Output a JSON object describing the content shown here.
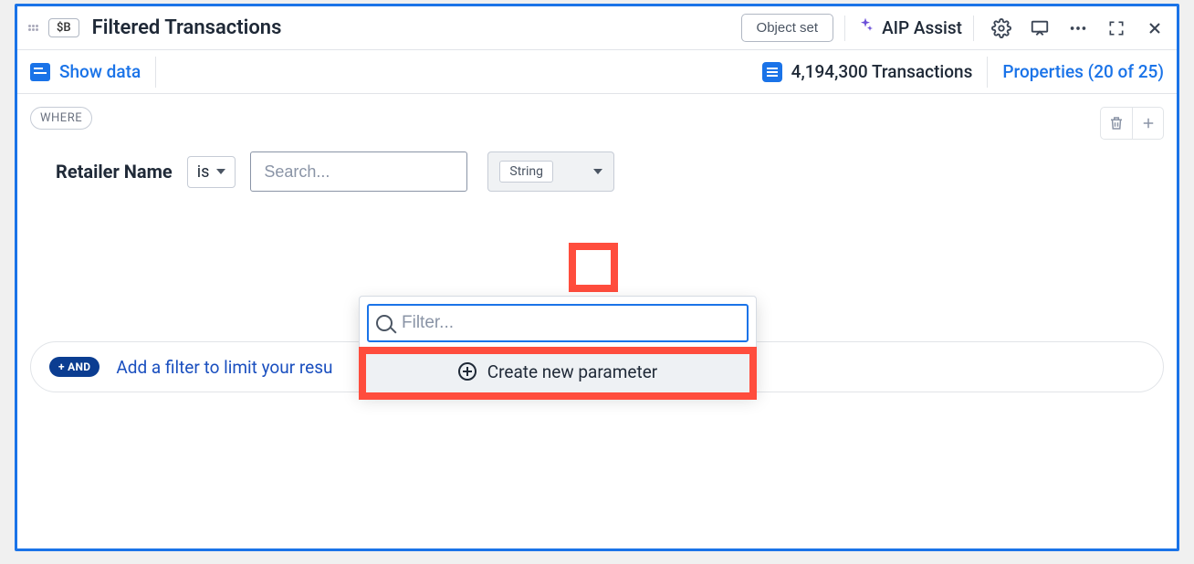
{
  "header": {
    "badge": "$B",
    "title": "Filtered Transactions",
    "object_set_btn": "Object set",
    "aip_label": "AIP Assist"
  },
  "infobar": {
    "show_data": "Show data",
    "tx_count": "4,194,300 Transactions",
    "properties_link": "Properties (20 of 25)"
  },
  "where": {
    "chip": "WHERE",
    "field": "Retailer Name",
    "operator": "is",
    "search_placeholder": "Search...",
    "type_label": "String"
  },
  "dropdown": {
    "filter_placeholder": "Filter...",
    "create_label": "Create new parameter"
  },
  "addfilter": {
    "pill": "+ AND",
    "text": "Add a filter to limit your resu"
  }
}
